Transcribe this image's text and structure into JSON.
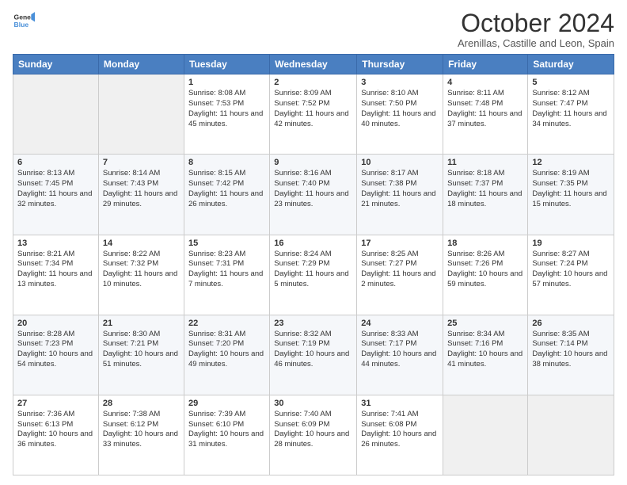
{
  "header": {
    "logo_line1": "General",
    "logo_line2": "Blue",
    "month": "October 2024",
    "location": "Arenillas, Castille and Leon, Spain"
  },
  "days_of_week": [
    "Sunday",
    "Monday",
    "Tuesday",
    "Wednesday",
    "Thursday",
    "Friday",
    "Saturday"
  ],
  "weeks": [
    [
      {
        "day": "",
        "content": ""
      },
      {
        "day": "",
        "content": ""
      },
      {
        "day": "1",
        "content": "Sunrise: 8:08 AM\nSunset: 7:53 PM\nDaylight: 11 hours and 45 minutes."
      },
      {
        "day": "2",
        "content": "Sunrise: 8:09 AM\nSunset: 7:52 PM\nDaylight: 11 hours and 42 minutes."
      },
      {
        "day": "3",
        "content": "Sunrise: 8:10 AM\nSunset: 7:50 PM\nDaylight: 11 hours and 40 minutes."
      },
      {
        "day": "4",
        "content": "Sunrise: 8:11 AM\nSunset: 7:48 PM\nDaylight: 11 hours and 37 minutes."
      },
      {
        "day": "5",
        "content": "Sunrise: 8:12 AM\nSunset: 7:47 PM\nDaylight: 11 hours and 34 minutes."
      }
    ],
    [
      {
        "day": "6",
        "content": "Sunrise: 8:13 AM\nSunset: 7:45 PM\nDaylight: 11 hours and 32 minutes."
      },
      {
        "day": "7",
        "content": "Sunrise: 8:14 AM\nSunset: 7:43 PM\nDaylight: 11 hours and 29 minutes."
      },
      {
        "day": "8",
        "content": "Sunrise: 8:15 AM\nSunset: 7:42 PM\nDaylight: 11 hours and 26 minutes."
      },
      {
        "day": "9",
        "content": "Sunrise: 8:16 AM\nSunset: 7:40 PM\nDaylight: 11 hours and 23 minutes."
      },
      {
        "day": "10",
        "content": "Sunrise: 8:17 AM\nSunset: 7:38 PM\nDaylight: 11 hours and 21 minutes."
      },
      {
        "day": "11",
        "content": "Sunrise: 8:18 AM\nSunset: 7:37 PM\nDaylight: 11 hours and 18 minutes."
      },
      {
        "day": "12",
        "content": "Sunrise: 8:19 AM\nSunset: 7:35 PM\nDaylight: 11 hours and 15 minutes."
      }
    ],
    [
      {
        "day": "13",
        "content": "Sunrise: 8:21 AM\nSunset: 7:34 PM\nDaylight: 11 hours and 13 minutes."
      },
      {
        "day": "14",
        "content": "Sunrise: 8:22 AM\nSunset: 7:32 PM\nDaylight: 11 hours and 10 minutes."
      },
      {
        "day": "15",
        "content": "Sunrise: 8:23 AM\nSunset: 7:31 PM\nDaylight: 11 hours and 7 minutes."
      },
      {
        "day": "16",
        "content": "Sunrise: 8:24 AM\nSunset: 7:29 PM\nDaylight: 11 hours and 5 minutes."
      },
      {
        "day": "17",
        "content": "Sunrise: 8:25 AM\nSunset: 7:27 PM\nDaylight: 11 hours and 2 minutes."
      },
      {
        "day": "18",
        "content": "Sunrise: 8:26 AM\nSunset: 7:26 PM\nDaylight: 10 hours and 59 minutes."
      },
      {
        "day": "19",
        "content": "Sunrise: 8:27 AM\nSunset: 7:24 PM\nDaylight: 10 hours and 57 minutes."
      }
    ],
    [
      {
        "day": "20",
        "content": "Sunrise: 8:28 AM\nSunset: 7:23 PM\nDaylight: 10 hours and 54 minutes."
      },
      {
        "day": "21",
        "content": "Sunrise: 8:30 AM\nSunset: 7:21 PM\nDaylight: 10 hours and 51 minutes."
      },
      {
        "day": "22",
        "content": "Sunrise: 8:31 AM\nSunset: 7:20 PM\nDaylight: 10 hours and 49 minutes."
      },
      {
        "day": "23",
        "content": "Sunrise: 8:32 AM\nSunset: 7:19 PM\nDaylight: 10 hours and 46 minutes."
      },
      {
        "day": "24",
        "content": "Sunrise: 8:33 AM\nSunset: 7:17 PM\nDaylight: 10 hours and 44 minutes."
      },
      {
        "day": "25",
        "content": "Sunrise: 8:34 AM\nSunset: 7:16 PM\nDaylight: 10 hours and 41 minutes."
      },
      {
        "day": "26",
        "content": "Sunrise: 8:35 AM\nSunset: 7:14 PM\nDaylight: 10 hours and 38 minutes."
      }
    ],
    [
      {
        "day": "27",
        "content": "Sunrise: 7:36 AM\nSunset: 6:13 PM\nDaylight: 10 hours and 36 minutes."
      },
      {
        "day": "28",
        "content": "Sunrise: 7:38 AM\nSunset: 6:12 PM\nDaylight: 10 hours and 33 minutes."
      },
      {
        "day": "29",
        "content": "Sunrise: 7:39 AM\nSunset: 6:10 PM\nDaylight: 10 hours and 31 minutes."
      },
      {
        "day": "30",
        "content": "Sunrise: 7:40 AM\nSunset: 6:09 PM\nDaylight: 10 hours and 28 minutes."
      },
      {
        "day": "31",
        "content": "Sunrise: 7:41 AM\nSunset: 6:08 PM\nDaylight: 10 hours and 26 minutes."
      },
      {
        "day": "",
        "content": ""
      },
      {
        "day": "",
        "content": ""
      }
    ]
  ]
}
